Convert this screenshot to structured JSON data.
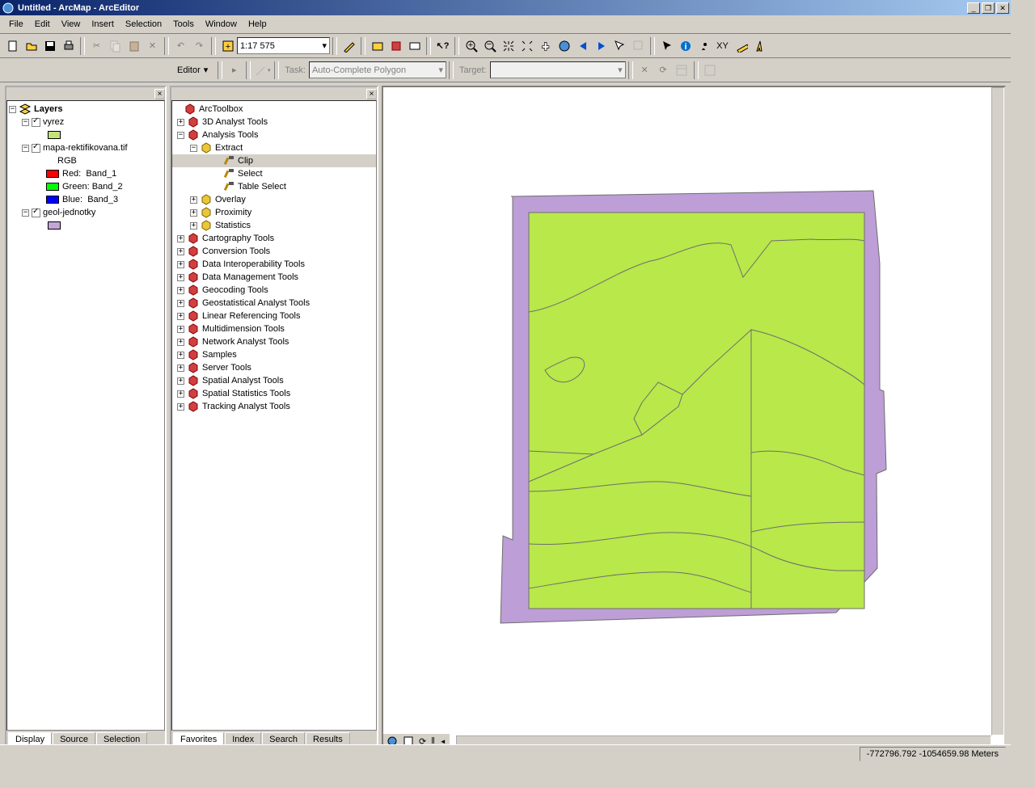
{
  "title": "Untitled - ArcMap - ArcEditor",
  "menu": [
    "File",
    "Edit",
    "View",
    "Insert",
    "Selection",
    "Tools",
    "Window",
    "Help"
  ],
  "scale": "1:17 575",
  "editor_label": "Editor",
  "task_label": "Task:",
  "task_value": "Auto-Complete Polygon",
  "target_label": "Target:",
  "toc": {
    "root": "Layers",
    "layers": [
      {
        "name": "vyrez",
        "swatch": "#c2e57a"
      },
      {
        "name": "mapa-rektifikovana.tif",
        "sub": "RGB",
        "bands": [
          {
            "name": "Red:",
            "val": "Band_1",
            "color": "#ff0000"
          },
          {
            "name": "Green:",
            "val": "Band_2",
            "color": "#00ff00"
          },
          {
            "name": "Blue:",
            "val": "Band_3",
            "color": "#0000ff"
          }
        ]
      },
      {
        "name": "geol-jednotky",
        "swatch": "#b89bd1"
      }
    ],
    "tabs": [
      "Display",
      "Source",
      "Selection"
    ]
  },
  "toolbox": {
    "root": "ArcToolbox",
    "items": [
      {
        "name": "3D Analyst Tools",
        "exp": false
      },
      {
        "name": "Analysis Tools",
        "exp": true,
        "children": [
          {
            "name": "Extract",
            "exp": true,
            "type": "set",
            "children": [
              {
                "name": "Clip",
                "type": "tool",
                "sel": true
              },
              {
                "name": "Select",
                "type": "tool"
              },
              {
                "name": "Table Select",
                "type": "tool"
              }
            ]
          },
          {
            "name": "Overlay",
            "exp": false,
            "type": "set"
          },
          {
            "name": "Proximity",
            "exp": false,
            "type": "set"
          },
          {
            "name": "Statistics",
            "exp": false,
            "type": "set"
          }
        ]
      },
      {
        "name": "Cartography Tools",
        "exp": false
      },
      {
        "name": "Conversion Tools",
        "exp": false
      },
      {
        "name": "Data Interoperability Tools",
        "exp": false
      },
      {
        "name": "Data Management Tools",
        "exp": false
      },
      {
        "name": "Geocoding Tools",
        "exp": false
      },
      {
        "name": "Geostatistical Analyst Tools",
        "exp": false
      },
      {
        "name": "Linear Referencing Tools",
        "exp": false
      },
      {
        "name": "Multidimension Tools",
        "exp": false
      },
      {
        "name": "Network Analyst Tools",
        "exp": false
      },
      {
        "name": "Samples",
        "exp": false
      },
      {
        "name": "Server Tools",
        "exp": false
      },
      {
        "name": "Spatial Analyst Tools",
        "exp": false
      },
      {
        "name": "Spatial Statistics Tools",
        "exp": false
      },
      {
        "name": "Tracking Analyst Tools",
        "exp": false
      }
    ],
    "tabs": [
      "Favorites",
      "Index",
      "Search",
      "Results"
    ]
  },
  "status_coord": "-772796.792 -1054659.98 Meters"
}
